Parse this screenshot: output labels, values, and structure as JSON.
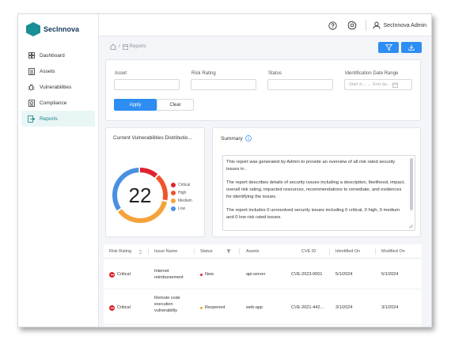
{
  "app": {
    "name": "SecInnova"
  },
  "header": {
    "user_name": "SecInnova Admin"
  },
  "sidebar": {
    "items": [
      {
        "label": "Dashboard"
      },
      {
        "label": "Assets"
      },
      {
        "label": "Vulnerabilities"
      },
      {
        "label": "Compliance"
      },
      {
        "label": "Reports"
      }
    ]
  },
  "breadcrumb": {
    "current": "Reports"
  },
  "filters": {
    "asset_label": "Asset",
    "risk_label": "Risk Rating",
    "status_label": "Status",
    "date_label": "Identification Date Range",
    "date_start_placeholder": "Start d...",
    "date_end_placeholder": "End da...",
    "apply_label": "Apply",
    "clear_label": "Clear"
  },
  "distribution": {
    "title": "Current Vulnerabilities Distributio...",
    "total": "22",
    "legend": [
      {
        "label": "Critical",
        "color": "#e0232e"
      },
      {
        "label": "High",
        "color": "#f0542d"
      },
      {
        "label": "Medium",
        "color": "#f6a23b"
      },
      {
        "label": "Low",
        "color": "#4a90e2"
      }
    ]
  },
  "summary": {
    "title": "Summary",
    "p1": "This report was generated by Admin to provide an overview of all risk rated security issues in .",
    "p2": "The report describes details of security issues including a description, likelihood, impact, overall risk rating, impacted resources, recommendations to remediate, and evidences for identifying the issues.",
    "p3": "The report includes 0 unresolved security issues including 0 critical, 0 high, 0 medium and 0 low risk rated issues."
  },
  "table": {
    "headers": {
      "risk": "Risk Rating",
      "issue": "Issue Name",
      "status": "Status",
      "assets": "Assets",
      "cve": "CVE ID",
      "identified": "Identified On",
      "modified": "Modified On"
    },
    "rows": [
      {
        "risk": "Critical",
        "issue": "Internet reimbursement",
        "status": "New",
        "status_color": "#e0232e",
        "assets": "api-server",
        "cve": "CVE-2023-0001",
        "identified": "5/1/2024",
        "modified": "5/1/2024"
      },
      {
        "risk": "Critical",
        "issue": "Remote code execution vulnerability",
        "status": "Reopened",
        "status_color": "#f6a23b",
        "assets": "web-app",
        "cve": "CVE-2021-442...",
        "identified": "3/1/2024",
        "modified": "3/1/2024"
      }
    ]
  }
}
